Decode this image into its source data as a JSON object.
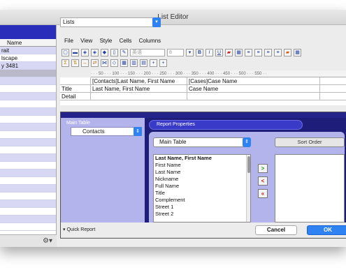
{
  "window": {
    "title": "List Editor"
  },
  "left_panel": {
    "column_header": "Name",
    "rows": [
      "rait",
      "lscape",
      "y 3481",
      "",
      "",
      "",
      "",
      "",
      "",
      "",
      "",
      "",
      "",
      "",
      "",
      "",
      "",
      "",
      "",
      "",
      "",
      "",
      "",
      ""
    ]
  },
  "lists_select": {
    "value": "Lists"
  },
  "menu": [
    "File",
    "View",
    "Style",
    "Cells",
    "Columns"
  ],
  "toolbar": {
    "font_placeholder": "英语",
    "size_value": "8"
  },
  "ruler": {
    "text": "· · · 50 · · · 100 · · · 150 · · · 200 · · · 250 · · · 300 · · · 350 · · · 400 · · · 450 · · · 500 · · · 550 · ·"
  },
  "grid": {
    "header_cells": [
      "[Contacts]Last Name, First Name",
      "[Cases]Case Name"
    ],
    "rows": [
      {
        "label": "Title",
        "cells": [
          "Last Name, First Name",
          "Case Name"
        ]
      },
      {
        "label": "Detail",
        "cells": [
          "",
          ""
        ]
      }
    ]
  },
  "dialog": {
    "main_table_label": "Main Table",
    "table_select": "Contacts",
    "tab_label": "Report Properties",
    "main_table_select": "Main Table",
    "fields": [
      "Last Name, First Name",
      "First Name",
      "Last Name",
      "Nickname",
      "Full Name",
      "Title",
      "Complement",
      "Street 1",
      "Street 2"
    ],
    "sort_order_label": "Sort Order",
    "move_buttons": [
      ">",
      "<",
      "«"
    ],
    "quick_report_label": "Quick Report",
    "cancel_label": "Cancel",
    "ok_label": "OK"
  },
  "colors": {
    "accent": "#2f82f2",
    "dark_navy": "#1e1e7a",
    "lavender": "#b4b4ec"
  }
}
